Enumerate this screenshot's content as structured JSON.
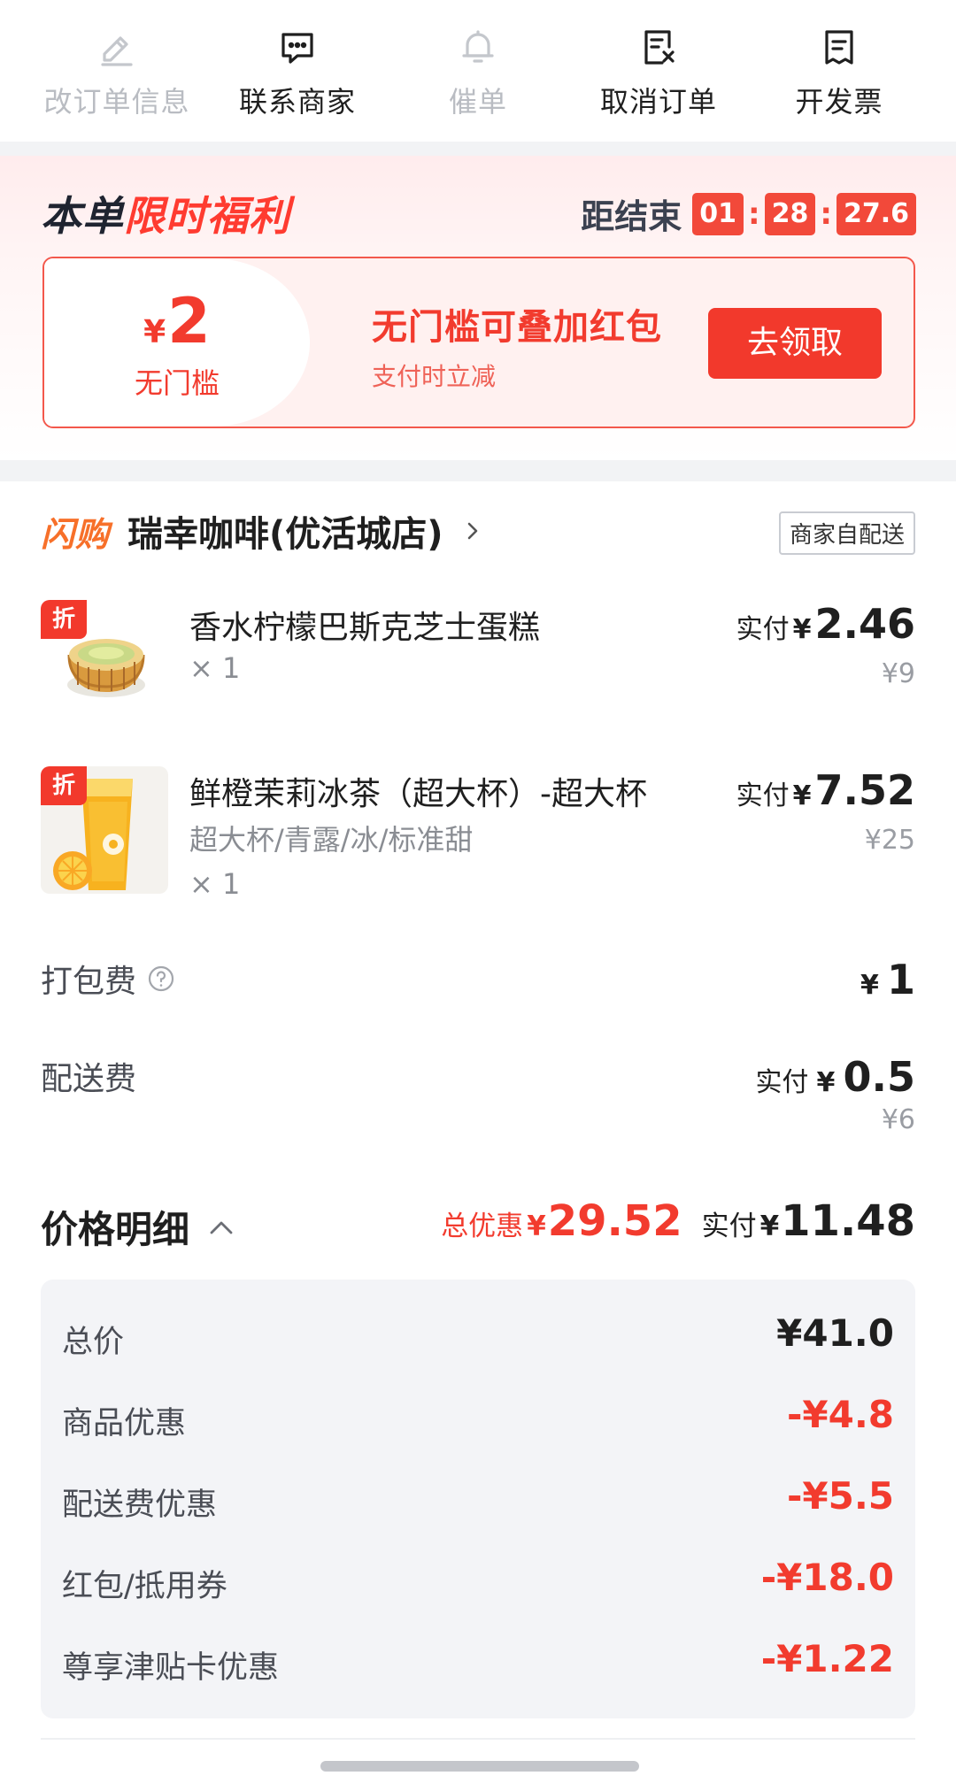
{
  "actions": [
    {
      "label": "改订单信息",
      "icon": "edit-icon",
      "disabled": true
    },
    {
      "label": "联系商家",
      "icon": "chat-icon",
      "disabled": false
    },
    {
      "label": "催单",
      "icon": "bell-icon",
      "disabled": true
    },
    {
      "label": "取消订单",
      "icon": "cancel-order-icon",
      "disabled": false
    },
    {
      "label": "开发票",
      "icon": "invoice-icon",
      "disabled": false
    }
  ],
  "promo": {
    "title_prefix": "本单",
    "title_highlight": "限时福利",
    "countdown_label": "距结束",
    "countdown": [
      "01",
      "28",
      "27.6"
    ],
    "coupon": {
      "currency": "¥",
      "amount": "2",
      "condition": "无门槛",
      "name": "无门槛可叠加红包",
      "subtitle": "支付时立减",
      "button": "去领取"
    }
  },
  "shop": {
    "tag": "闪购",
    "name": "瑞幸咖啡(优活城店)",
    "delivery": "商家自配送"
  },
  "items": [
    {
      "badge": "折",
      "name": "香水柠檬巴斯克芝士蛋糕",
      "spec": "",
      "qty": "× 1",
      "paid_label": "实付",
      "currency": "¥",
      "paid": "2.46",
      "original": "¥9"
    },
    {
      "badge": "折",
      "name": "鲜橙茉莉冰茶（超大杯）-超大杯",
      "spec": "超大杯/青露/冰/标准甜",
      "qty": "× 1",
      "paid_label": "实付",
      "currency": "¥",
      "paid": "7.52",
      "original": "¥25"
    }
  ],
  "fees": {
    "packing": {
      "label": "打包费",
      "currency": "¥",
      "value": "1"
    },
    "delivery": {
      "label": "配送费",
      "paid_label": "实付",
      "currency": "¥",
      "value": "0.5",
      "original": "¥6"
    }
  },
  "price_detail": {
    "title": "价格明细",
    "total_discount_label": "总优惠",
    "currency": "¥",
    "total_discount": "29.52",
    "paid_label": "实付",
    "paid": "11.48",
    "rows": [
      {
        "label": "总价",
        "value": "¥41.0",
        "negative": false
      },
      {
        "label": "商品优惠",
        "value": "-¥4.8",
        "negative": true
      },
      {
        "label": "配送费优惠",
        "value": "-¥5.5",
        "negative": true
      },
      {
        "label": "红包/抵用券",
        "value": "-¥18.0",
        "negative": true
      },
      {
        "label": "尊享津贴卡优惠",
        "value": "-¥1.22",
        "negative": true
      }
    ]
  },
  "colors": {
    "accent_red": "#f2392c",
    "shop_tag_orange": "#f7702a",
    "disabled_gray": "#b9bcc2"
  }
}
